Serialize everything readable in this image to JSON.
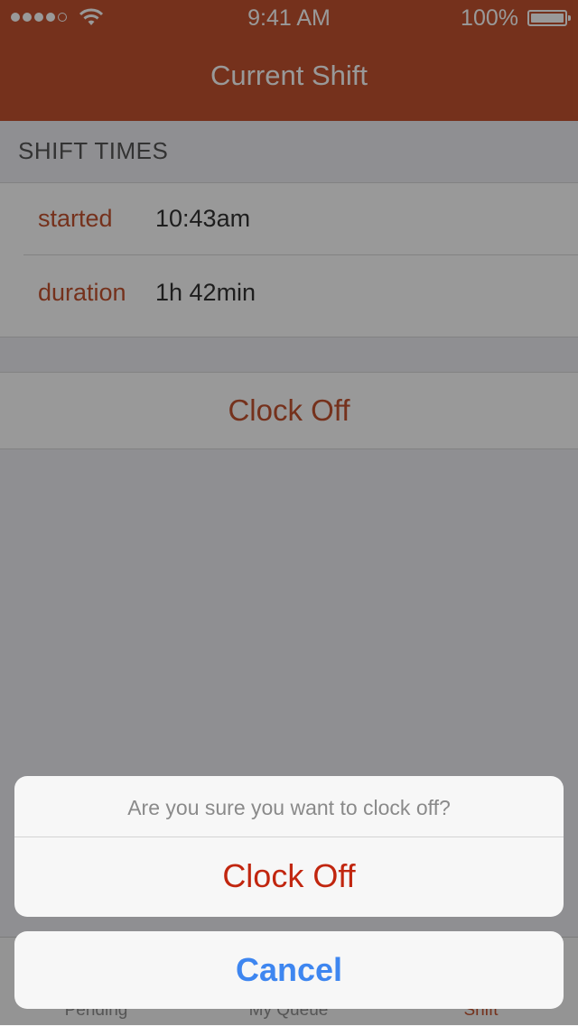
{
  "status_bar": {
    "time": "9:41 AM",
    "battery_percent": "100%",
    "signal_bars_filled": 4,
    "signal_bars_total": 5,
    "signal_icon": "signal-dots-icon",
    "wifi_icon": "wifi-icon",
    "battery_icon": "battery-icon"
  },
  "nav": {
    "title": "Current Shift"
  },
  "shift": {
    "section_header": "SHIFT TIMES",
    "rows": [
      {
        "label": "started",
        "value": "10:43am"
      },
      {
        "label": "duration",
        "value": "1h 42min"
      }
    ]
  },
  "clock_off_button": {
    "label": "Clock Off"
  },
  "tabbar": {
    "tabs": [
      {
        "label": "Pending"
      },
      {
        "label": "My Queue"
      },
      {
        "label": "Shift"
      }
    ],
    "active_index": 2
  },
  "action_sheet": {
    "message": "Are you sure you want to clock off?",
    "destructive_label": "Clock Off",
    "cancel_label": "Cancel"
  },
  "colors": {
    "brand": "#c4532f",
    "destructive": "#c1260f",
    "cancel": "#3e86f0"
  }
}
